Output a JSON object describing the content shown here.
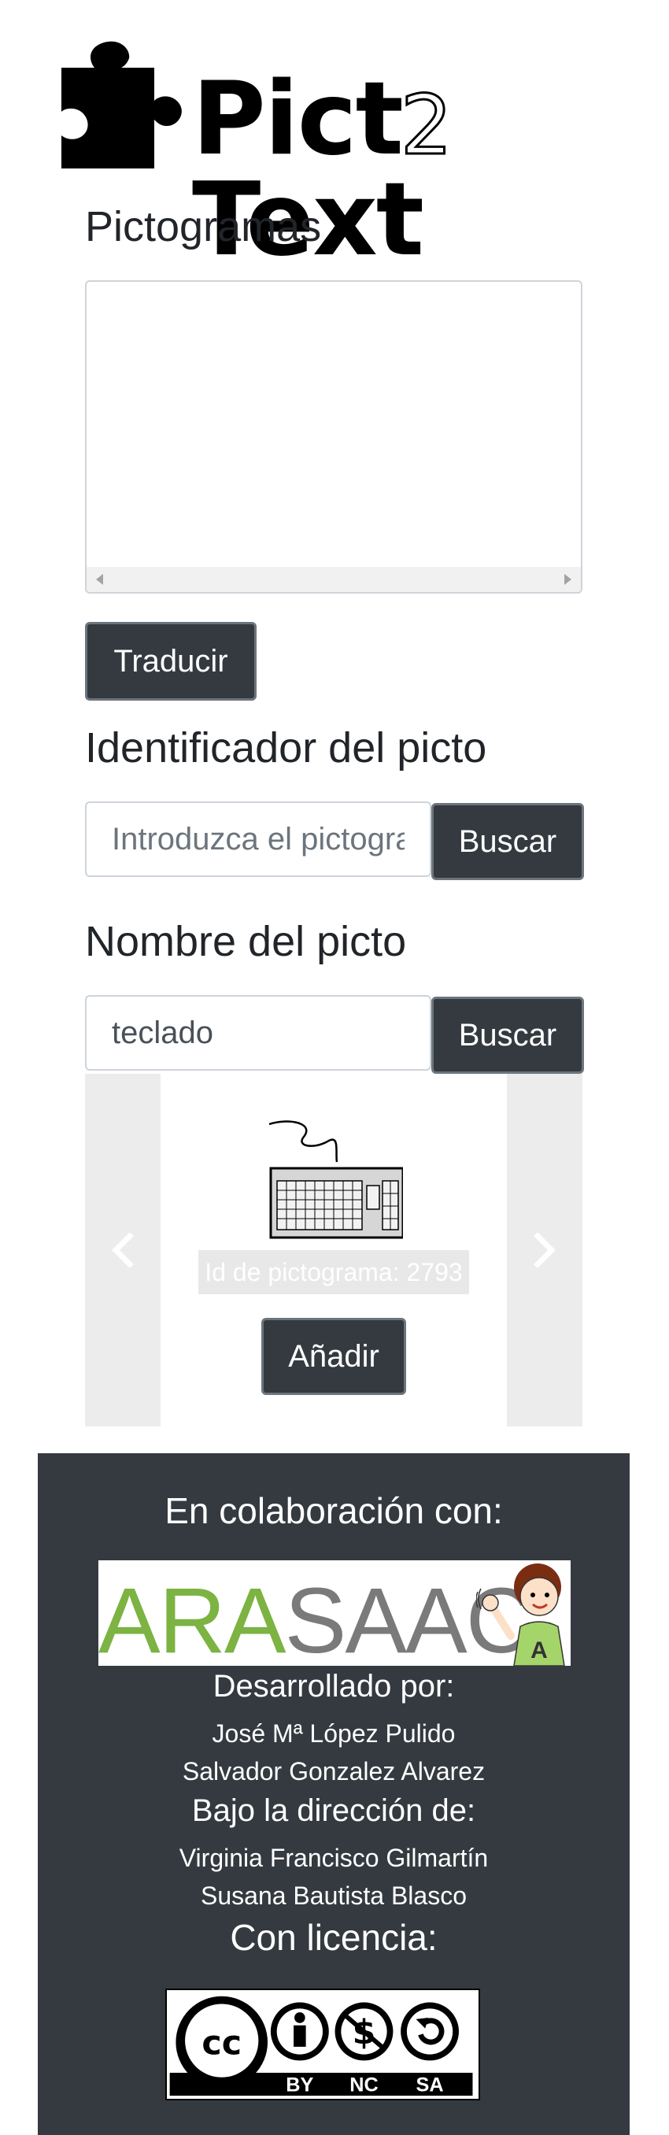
{
  "brand": {
    "logo_alt": "Pict2Text",
    "logo_left": "Pict",
    "logo_two": "2",
    "logo_right": "Text"
  },
  "pictogramas": {
    "heading": "Pictogramas",
    "translate_button": "Traducir"
  },
  "id_search": {
    "heading": "Identificador del picto",
    "placeholder": "Introduzca el pictograma",
    "value": "",
    "button": "Buscar"
  },
  "name_search": {
    "heading": "Nombre del picto",
    "value": "teclado",
    "button": "Buscar"
  },
  "carousel": {
    "prev_icon": "chevron-left-icon",
    "next_icon": "chevron-right-icon",
    "image_icon": "keyboard-pictogram",
    "caption": "Id de pictograma: 2793",
    "add_button": "Añadir"
  },
  "footer": {
    "collab_heading": "En colaboración con:",
    "partner_logo_text": "ARASAAC",
    "partner_logo_colors": {
      "green": "#7cb342",
      "gray": "#7a7a7a"
    },
    "developed_heading": "Desarrollado por:",
    "developers": [
      "José Mª López Pulido",
      "Salvador Gonzalez Alvarez"
    ],
    "direction_heading": "Bajo la dirección de:",
    "directors": [
      "Virginia Francisco Gilmartín",
      "Susana Bautista Blasco"
    ],
    "license_heading": "Con licencia:",
    "license_labels": [
      "BY",
      "NC",
      "SA"
    ],
    "license_logo_text": "cc"
  },
  "colors": {
    "dark": "#343a40",
    "button_border": "#6c757d",
    "input_border": "#ced4da"
  }
}
